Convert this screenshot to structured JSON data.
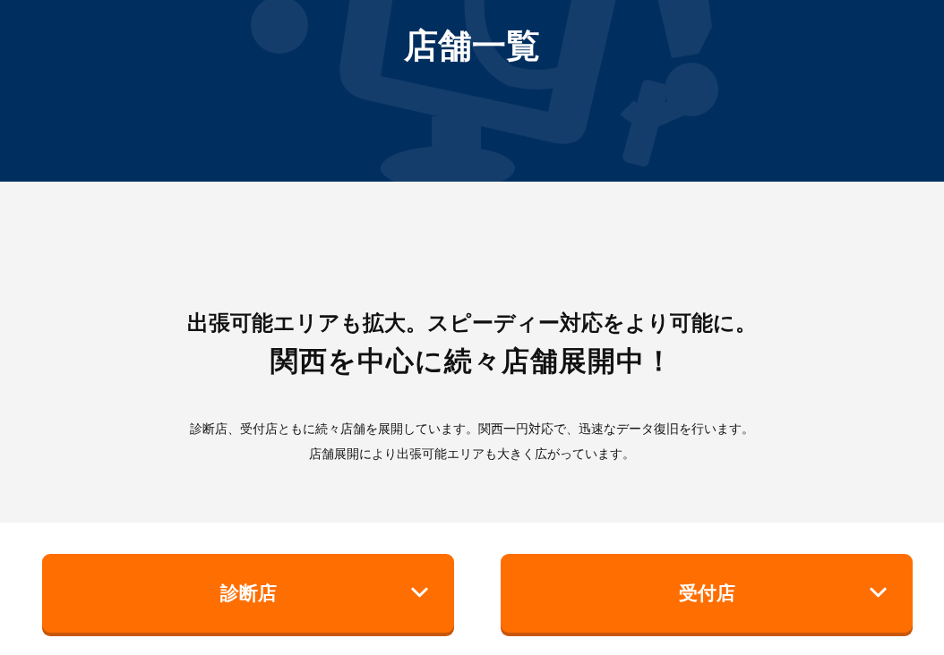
{
  "header": {
    "title": "店舗一覧"
  },
  "intro": {
    "lead": "出張可能エリアも拡大。スピーディー対応をより可能に。",
    "headline": "関西を中心に続々店舗展開中！",
    "paragraphs": [
      "診断店、受付店ともに続々店舗を展開しています。関西一円対応で、迅速なデータ復旧を行います。",
      "店舗展開により出張可能エリアも大きく広がっています。"
    ]
  },
  "accordions": [
    {
      "label": "診断店",
      "expanded": false
    },
    {
      "label": "受付店",
      "expanded": false
    }
  ]
}
